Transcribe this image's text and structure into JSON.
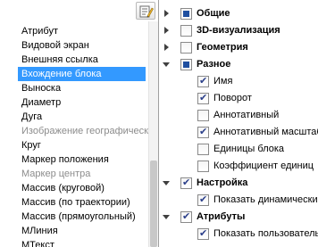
{
  "left_list": {
    "items": [
      {
        "label": "Атрибут",
        "enabled": true
      },
      {
        "label": "Видовой экран",
        "enabled": true
      },
      {
        "label": "Внешняя ссылка",
        "enabled": true
      },
      {
        "label": "Вхождение блока",
        "enabled": true,
        "selected": true
      },
      {
        "label": "Выноска",
        "enabled": true
      },
      {
        "label": "Диаметр",
        "enabled": true
      },
      {
        "label": "Дуга",
        "enabled": true
      },
      {
        "label": "Изображение географической карты",
        "enabled": false
      },
      {
        "label": "Круг",
        "enabled": true
      },
      {
        "label": "Маркер положения",
        "enabled": true
      },
      {
        "label": "Маркер центра",
        "enabled": false
      },
      {
        "label": "Массив (круговой)",
        "enabled": true
      },
      {
        "label": "Массив (по траектории)",
        "enabled": true
      },
      {
        "label": "Массив (прямоугольный)",
        "enabled": true
      },
      {
        "label": "МЛиния",
        "enabled": true
      },
      {
        "label": "МТекст",
        "enabled": true
      }
    ]
  },
  "right_tree": {
    "rows": [
      {
        "label": "Общие",
        "level": 0,
        "state": "partial",
        "expanded": false,
        "bold": true
      },
      {
        "label": "3D-визуализация",
        "level": 0,
        "state": "unchecked",
        "expanded": false,
        "bold": true
      },
      {
        "label": "Геометрия",
        "level": 0,
        "state": "unchecked",
        "expanded": false,
        "bold": true
      },
      {
        "label": "Разное",
        "level": 0,
        "state": "partial",
        "expanded": true,
        "bold": true
      },
      {
        "label": "Имя",
        "level": 1,
        "state": "checked"
      },
      {
        "label": "Поворот",
        "level": 1,
        "state": "checked"
      },
      {
        "label": "Аннотативный",
        "level": 1,
        "state": "unchecked"
      },
      {
        "label": "Аннотативный масштаб",
        "level": 1,
        "state": "checked"
      },
      {
        "label": "Единицы блока",
        "level": 1,
        "state": "unchecked"
      },
      {
        "label": "Коэффициент единиц",
        "level": 1,
        "state": "unchecked"
      },
      {
        "label": "Настройка",
        "level": 0,
        "state": "checked",
        "expanded": true,
        "bold": true
      },
      {
        "label": "Показать динамические",
        "level": 1,
        "state": "checked"
      },
      {
        "label": "Атрибуты",
        "level": 0,
        "state": "checked",
        "expanded": true,
        "bold": true
      },
      {
        "label": "Показать пользовательские",
        "level": 1,
        "state": "checked"
      }
    ]
  },
  "icons": {
    "toolbar": "edit-list-icon"
  },
  "colors": {
    "selection": "#3399ff",
    "partial_fill": "#1f4fa0",
    "check": "#2b3f8a",
    "disabled_text": "#8c8c8c"
  }
}
